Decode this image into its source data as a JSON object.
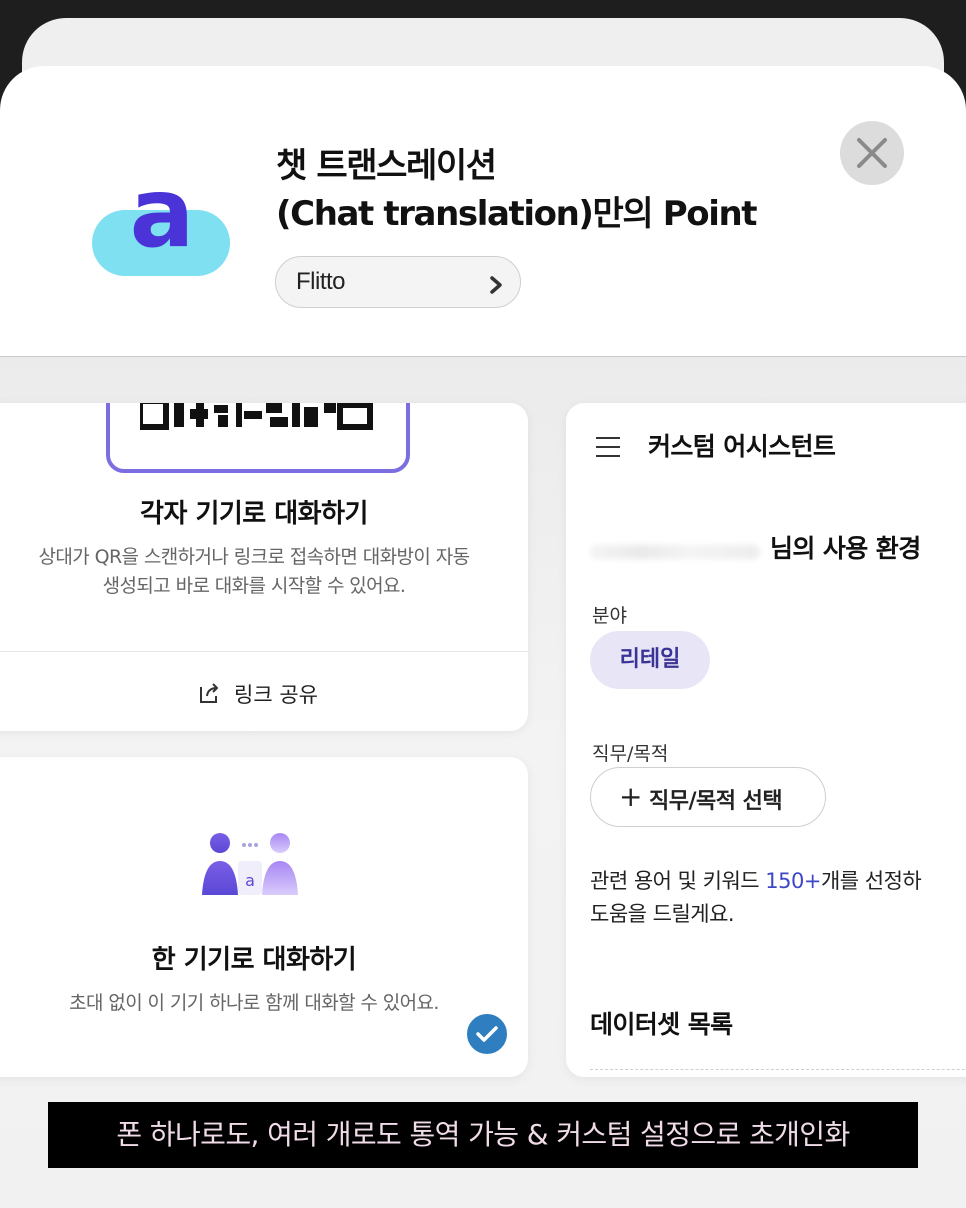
{
  "app": {
    "title_line1": "챗 트랜스레이션",
    "title_line2": "(Chat translation)만의 Point",
    "developer": "Flitto"
  },
  "icons": {
    "app_logo": "app-logo-icon",
    "close": "close-icon",
    "chevron": "chevron-right-icon",
    "share": "share-link-icon",
    "menu": "hamburger-menu-icon",
    "people": "two-people-icon",
    "check": "check-icon",
    "qr": "qr-code-icon"
  },
  "colors": {
    "accent_purple": "#7b6ee0",
    "keyword_blue": "#3f46c7",
    "check_blue": "#2f7fc0",
    "caption_bg": "#000000"
  },
  "screen_left": {
    "card_multi": {
      "title": "각자 기기로 대화하기",
      "desc_line1": "상대가 QR을 스캔하거나 링크로 접속하면 대화방이 자동",
      "desc_line2": "생성되고 바로 대화를 시작할 수 있어요.",
      "share_label": "링크 공유"
    },
    "card_single": {
      "title": "한 기기로 대화하기",
      "desc": "초대 없이 이 기기 하나로 함께 대화할 수 있어요."
    }
  },
  "screen_right": {
    "header_title": "커스텀 어시스턴트",
    "env_title": "님의 사용 환경",
    "field_label": "분야",
    "field_value": "리테일",
    "job_label": "직무/목적",
    "job_button": "직무/목적 선택",
    "keywords_prefix": "관련 용어 및 키워드 ",
    "keywords_count": "150+",
    "keywords_suffix": "개를 선정하",
    "keywords_line2": "도움을 드릴게요.",
    "dataset_title": "데이터셋 목록"
  },
  "caption": "폰 하나로도, 여러 개로도 통역 가능 & 커스텀 설정으로 초개인화"
}
